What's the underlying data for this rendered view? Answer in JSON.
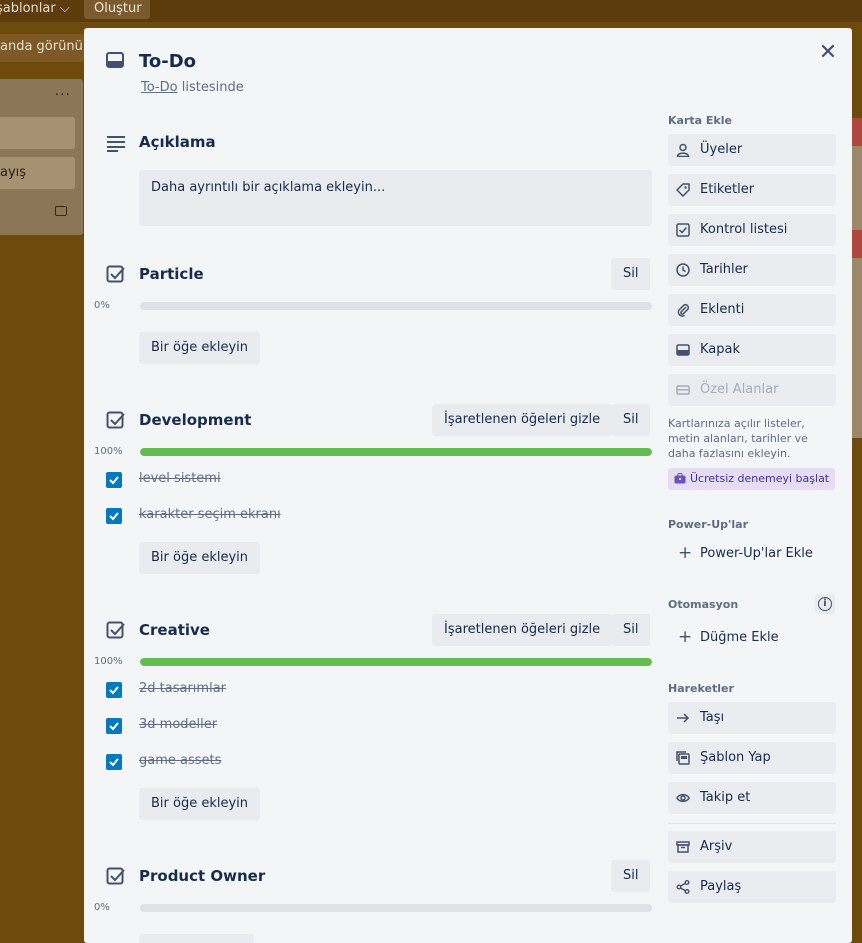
{
  "background": {
    "topbar_views": "şablonlar",
    "topbar_create": "Oluştur",
    "header_btn": "anda görünür",
    "list_card_text": "ayış",
    "list_menu": "···"
  },
  "card": {
    "title": "To-Do",
    "list_name": "To-Do",
    "list_suffix": " listesinde"
  },
  "description": {
    "title": "Açıklama",
    "placeholder": "Daha ayrıntılı bir açıklama ekleyin..."
  },
  "checklists": [
    {
      "title": "Particle",
      "progress_label": "0%",
      "progress": 0,
      "hide_label": "",
      "delete_label": "Sil",
      "add_label": "Bir öğe ekleyin",
      "items": []
    },
    {
      "title": "Development",
      "progress_label": "100%",
      "progress": 100,
      "hide_label": "İşaretlenen öğeleri gizle",
      "delete_label": "Sil",
      "add_label": "Bir öğe ekleyin",
      "items": [
        "level sistemi",
        "karakter seçim ekranı"
      ]
    },
    {
      "title": "Creative",
      "progress_label": "100%",
      "progress": 100,
      "hide_label": "İşaretlenen öğeleri gizle",
      "delete_label": "Sil",
      "add_label": "Bir öğe ekleyin",
      "items": [
        "2d tasarımlar",
        "3d modeller",
        "game assets"
      ]
    },
    {
      "title": "Product Owner",
      "progress_label": "0%",
      "progress": 0,
      "hide_label": "",
      "delete_label": "Sil",
      "add_label": "",
      "items": []
    }
  ],
  "sidebar": {
    "add_to_card_heading": "Karta Ekle",
    "add_to_card": [
      {
        "label": "Üyeler",
        "icon": "person-icon"
      },
      {
        "label": "Etiketler",
        "icon": "tag-icon"
      },
      {
        "label": "Kontrol listesi",
        "icon": "checklist-icon"
      },
      {
        "label": "Tarihler",
        "icon": "clock-icon"
      },
      {
        "label": "Eklenti",
        "icon": "paperclip-icon"
      },
      {
        "label": "Kapak",
        "icon": "cover-icon"
      },
      {
        "label": "Özel Alanlar",
        "icon": "custom-fields-icon"
      }
    ],
    "custom_fields_info": "Kartlarınıza açılır listeler, metin alanları, tarihler ve daha fazlasını ekleyin.",
    "trial_label": "Ücretsiz denemeyi başlat",
    "powerups_heading": "Power-Up'lar",
    "powerups_add": "Power-Up'lar Ekle",
    "automation_heading": "Otomasyon",
    "automation_add": "Düğme Ekle",
    "actions_heading": "Hareketler",
    "actions": [
      {
        "label": "Taşı",
        "icon": "arrow-right-icon"
      },
      {
        "label": "Şablon Yap",
        "icon": "template-icon"
      },
      {
        "label": "Takip et",
        "icon": "eye-icon"
      },
      {
        "label": "Arşiv",
        "icon": "archive-icon"
      },
      {
        "label": "Paylaş",
        "icon": "share-icon"
      }
    ]
  },
  "colors": {
    "progress_fill": "#61bd4f",
    "checkbox": "#0079bf",
    "modal_bg": "#f4f5f7"
  }
}
